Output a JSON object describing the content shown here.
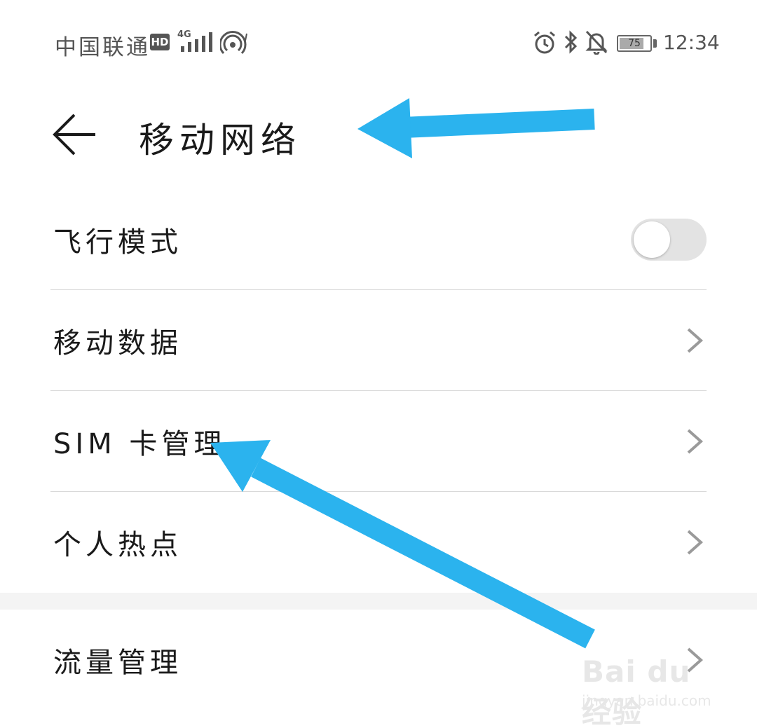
{
  "status_bar": {
    "carrier": "中国联通",
    "hd_badge": "HD",
    "network_type": "4G",
    "battery_percent": "75",
    "time": "12:34",
    "icons": [
      "hd-icon",
      "signal-icon",
      "hotspot-icon",
      "alarm-icon",
      "bluetooth-icon",
      "mute-icon",
      "battery-icon"
    ]
  },
  "header": {
    "title": "移动网络",
    "back_icon": "back-arrow-icon"
  },
  "settings": {
    "items": [
      {
        "label": "飞行模式",
        "control": "toggle",
        "toggle_on": false
      },
      {
        "label": "移动数据",
        "control": "chevron"
      },
      {
        "label": "SIM 卡管理",
        "control": "chevron"
      },
      {
        "label": "个人热点",
        "control": "chevron"
      },
      {
        "label": "流量管理",
        "control": "chevron"
      }
    ]
  },
  "annotation": {
    "arrow_color": "#2bb3ee"
  },
  "watermark": {
    "brand": "Bai du 经验",
    "url": "jingyan.baidu.com"
  },
  "colors": {
    "background": "#ffffff",
    "text": "#1a1a1a",
    "divider": "#d9d9d9",
    "toggle_off": "#e3e3e3",
    "chevron": "#9a9a9a"
  }
}
